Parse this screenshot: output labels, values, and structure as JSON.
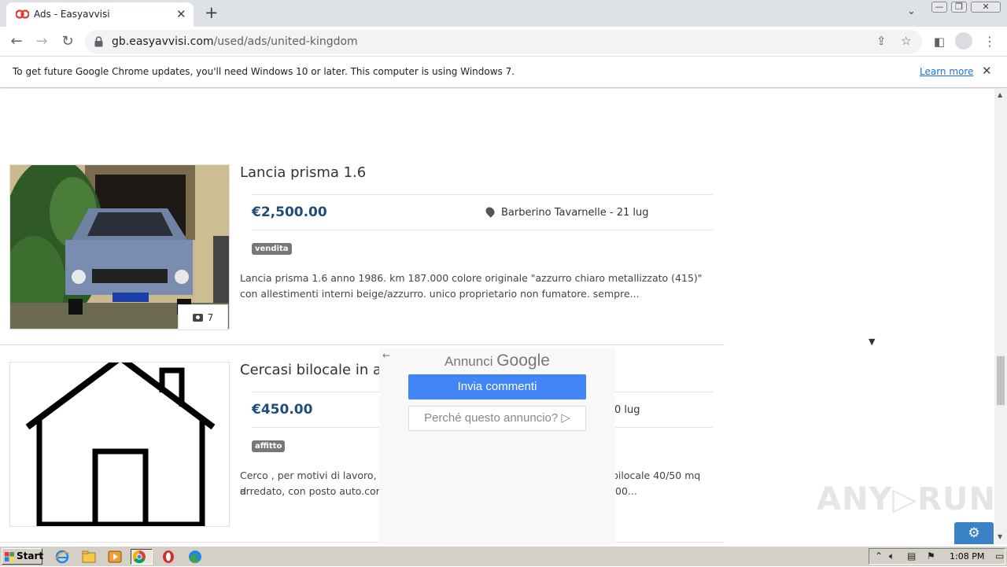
{
  "browser": {
    "tab_title": "Ads - Easyavvisi",
    "tab_close": "✕",
    "new_tab": "+",
    "tab_search": "⌄",
    "url_host": "gb.easyavvisi.com",
    "url_path": "/used/ads/united-kingdom",
    "window_controls": {
      "minimize": "—",
      "restore": "❐",
      "close": "✕"
    }
  },
  "infobar": {
    "message": "To get future Google Chrome updates, you'll need Windows 10 or later. This computer is using Windows 7.",
    "link": "Learn more",
    "close": "✕"
  },
  "listings": [
    {
      "title": "Lancia prisma 1.6",
      "price": "€2,500.00",
      "location": "Barberino Tavarnelle - 21 lug",
      "badge": "vendita",
      "description": "Lancia prisma 1.6 anno 1986. km 187.000 colore originale \"azzurro chiaro metallizzato (415)\" con allestimenti interni beige/azzurro. unico proprietario non fumatore. sempre...",
      "photo_count": "7"
    },
    {
      "title": "Cercasi bilocale in a",
      "price": "€450.00",
      "location": "0 lug",
      "badge": "affitto",
      "description_line1": "Cerco , per motivi di lavoro, d",
      "description_line1_tail": "bilocale 40/50 mq",
      "description_line2": "arredato, con posto auto.cor",
      "description_line2_tail": "00..."
    }
  ],
  "google_ad": {
    "back": "←",
    "label_prefix": "Annunci",
    "label_brand": "Google",
    "primary_button": "Invia commenti",
    "secondary_button": "Perché questo annuncio? ▷"
  },
  "page": {
    "dropdown_arrow": "▼",
    "watermark": "ANY▷RUN",
    "settings_icon": "⚙"
  },
  "taskbar": {
    "start": "Start",
    "clock": "1:08 PM"
  }
}
